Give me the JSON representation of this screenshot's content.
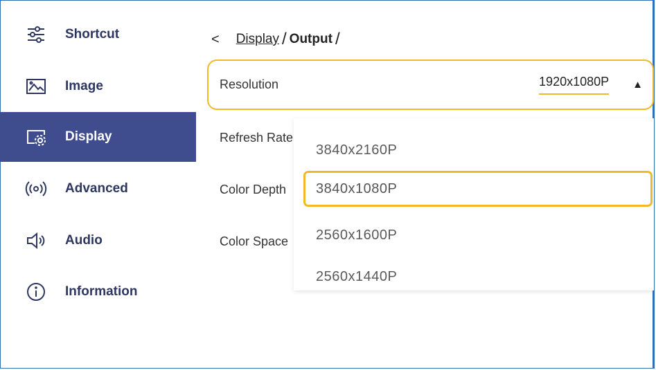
{
  "sidebar": {
    "items": [
      {
        "label": "Shortcut",
        "icon": "sliders-icon"
      },
      {
        "label": "Image",
        "icon": "image-icon"
      },
      {
        "label": "Display",
        "icon": "display-settings-icon",
        "active": true
      },
      {
        "label": "Advanced",
        "icon": "broadcast-icon"
      },
      {
        "label": "Audio",
        "icon": "speaker-icon"
      },
      {
        "label": "Information",
        "icon": "info-icon"
      }
    ]
  },
  "breadcrumb": {
    "back": "<",
    "parent": "Display",
    "separator": "/",
    "current": "Output",
    "trailing": "/"
  },
  "settings": {
    "resolution": {
      "label": "Resolution",
      "value": "1920x1080P",
      "arrow": "▲"
    },
    "refresh_rate": {
      "label": "Refresh Rate"
    },
    "color_depth": {
      "label": "Color Depth"
    },
    "color_space": {
      "label": "Color Space"
    }
  },
  "dropdown": {
    "options": [
      "3840x2160P",
      "3840x1080P",
      "2560x1600P",
      "2560x1440P"
    ],
    "highlighted_index": 1
  },
  "colors": {
    "accent": "#f1b927",
    "sidebar_active": "#3f4d8e",
    "frame": "#2f6fb8"
  }
}
